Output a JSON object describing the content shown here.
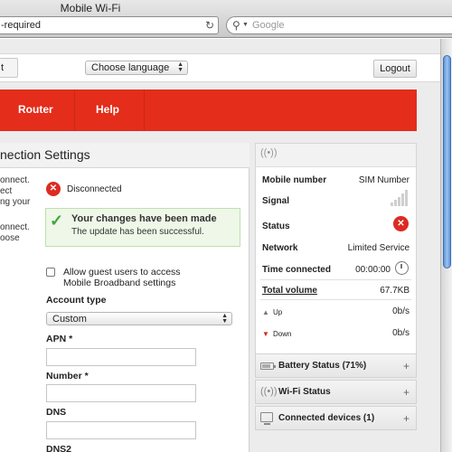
{
  "browser": {
    "window_title": "Mobile Wi-Fi",
    "url_text": "-required",
    "search_placeholder": "Google"
  },
  "topbar": {
    "tab_stub_label": "t",
    "language_select": "Choose language",
    "logout_label": "Logout"
  },
  "nav": {
    "items": [
      {
        "label": "Router"
      },
      {
        "label": "Help"
      }
    ]
  },
  "left": {
    "title": "nection Settings",
    "side_text_1": [
      "onnect.",
      "ect",
      "ng your"
    ],
    "side_text_2": [
      "onnect.",
      "oose"
    ],
    "status_text": "Disconnected",
    "notice_title": "Your changes have been made",
    "notice_sub": "The update has been successful.",
    "guest_label_1": "Allow guest users to access",
    "guest_label_2": "Mobile Broadband settings",
    "account_type_label": "Account type",
    "account_type_value": "Custom",
    "apn_label": "APN *",
    "number_label": "Number *",
    "dns_label": "DNS",
    "dns2_label": "DNS2"
  },
  "right": {
    "rows": {
      "mobile_number": {
        "label": "Mobile number",
        "value": "SIM Number"
      },
      "signal": {
        "label": "Signal"
      },
      "status": {
        "label": "Status"
      },
      "network": {
        "label": "Network",
        "value": "Limited Service"
      },
      "time_connected": {
        "label": "Time connected",
        "value": "00:00:00"
      },
      "total_volume": {
        "label": "Total volume",
        "value": "67.7KB"
      },
      "up": {
        "label": "Up",
        "value": "0b/s"
      },
      "down": {
        "label": "Down",
        "value": "0b/s"
      }
    },
    "accordions": {
      "battery": "Battery Status (71%)",
      "wifi": "Wi-Fi Status",
      "devices": "Connected devices (1)"
    }
  },
  "colors": {
    "nav_red": "#e42d1b",
    "error_red": "#dc2b22",
    "success_green": "#3fa63a",
    "scroll_blue": "#5d93d8"
  }
}
